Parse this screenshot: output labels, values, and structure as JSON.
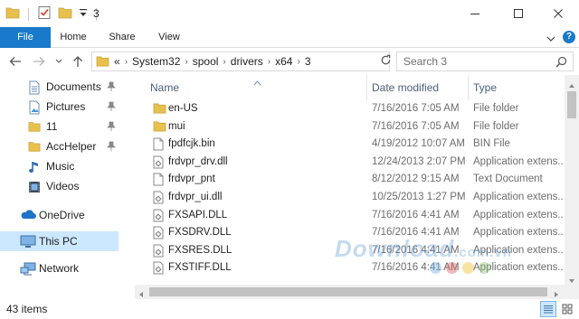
{
  "window": {
    "title": "3",
    "controls": {
      "minimize": "minimize",
      "maximize": "maximize",
      "close": "close"
    }
  },
  "ribbon": {
    "tabs": [
      {
        "label": "File",
        "active": true
      },
      {
        "label": "Home"
      },
      {
        "label": "Share"
      },
      {
        "label": "View"
      }
    ],
    "help": "?"
  },
  "address": {
    "overflow": "«",
    "crumbs": [
      "System32",
      "spool",
      "drivers",
      "x64",
      "3"
    ]
  },
  "search": {
    "placeholder": "Search 3"
  },
  "navpane": {
    "items": [
      {
        "label": "Documents",
        "icon": "documents-icon",
        "pinned": true
      },
      {
        "label": "Pictures",
        "icon": "pictures-icon",
        "pinned": true
      },
      {
        "label": "11",
        "icon": "folder-icon",
        "pinned": true
      },
      {
        "label": "AccHelper",
        "icon": "folder-icon",
        "pinned": true
      },
      {
        "label": "Music",
        "icon": "music-icon",
        "pinned": false
      },
      {
        "label": "Videos",
        "icon": "videos-icon",
        "pinned": false
      },
      {
        "label": "OneDrive",
        "icon": "onedrive-icon",
        "pinned": false
      },
      {
        "label": "This PC",
        "icon": "this-pc-icon",
        "pinned": false,
        "selected": true
      },
      {
        "label": "Network",
        "icon": "network-icon",
        "pinned": false
      }
    ]
  },
  "columns": {
    "name": "Name",
    "date": "Date modified",
    "type": "Type"
  },
  "files": [
    {
      "name": "en-US",
      "date": "7/16/2016 7:05 AM",
      "type": "File folder",
      "icon": "folder"
    },
    {
      "name": "mui",
      "date": "7/16/2016 7:05 AM",
      "type": "File folder",
      "icon": "folder"
    },
    {
      "name": "fpdfcjk.bin",
      "date": "4/19/2012 10:07 AM",
      "type": "BIN File",
      "icon": "file"
    },
    {
      "name": "frdvpr_drv.dll",
      "date": "12/24/2013 2:07 PM",
      "type": "Application extens...",
      "icon": "dll"
    },
    {
      "name": "frdvpr_pnt",
      "date": "8/12/2012 9:15 AM",
      "type": "Text Document",
      "icon": "file"
    },
    {
      "name": "frdvpr_ui.dll",
      "date": "10/25/2013 1:27 PM",
      "type": "Application extens...",
      "icon": "dll"
    },
    {
      "name": "FXSAPI.DLL",
      "date": "7/16/2016 4:41 AM",
      "type": "Application extens...",
      "icon": "dll"
    },
    {
      "name": "FXSDRV.DLL",
      "date": "7/16/2016 4:41 AM",
      "type": "Application extens...",
      "icon": "dll"
    },
    {
      "name": "FXSRES.DLL",
      "date": "7/16/2016 4:41 AM",
      "type": "Application extens...",
      "icon": "dll"
    },
    {
      "name": "FXSTIFF.DLL",
      "date": "7/16/2016 4:41 AM",
      "type": "Application extens...",
      "icon": "dll"
    }
  ],
  "status": {
    "item_count": "43 items"
  },
  "watermark": {
    "text": "Download",
    "suffix": ".com.vn"
  },
  "colors": {
    "accent": "#1979ca",
    "selected_bg": "#cce8ff",
    "folder": "#e8c04d",
    "header_text": "#4c607a",
    "secondary_text": "#6d6d6d"
  }
}
